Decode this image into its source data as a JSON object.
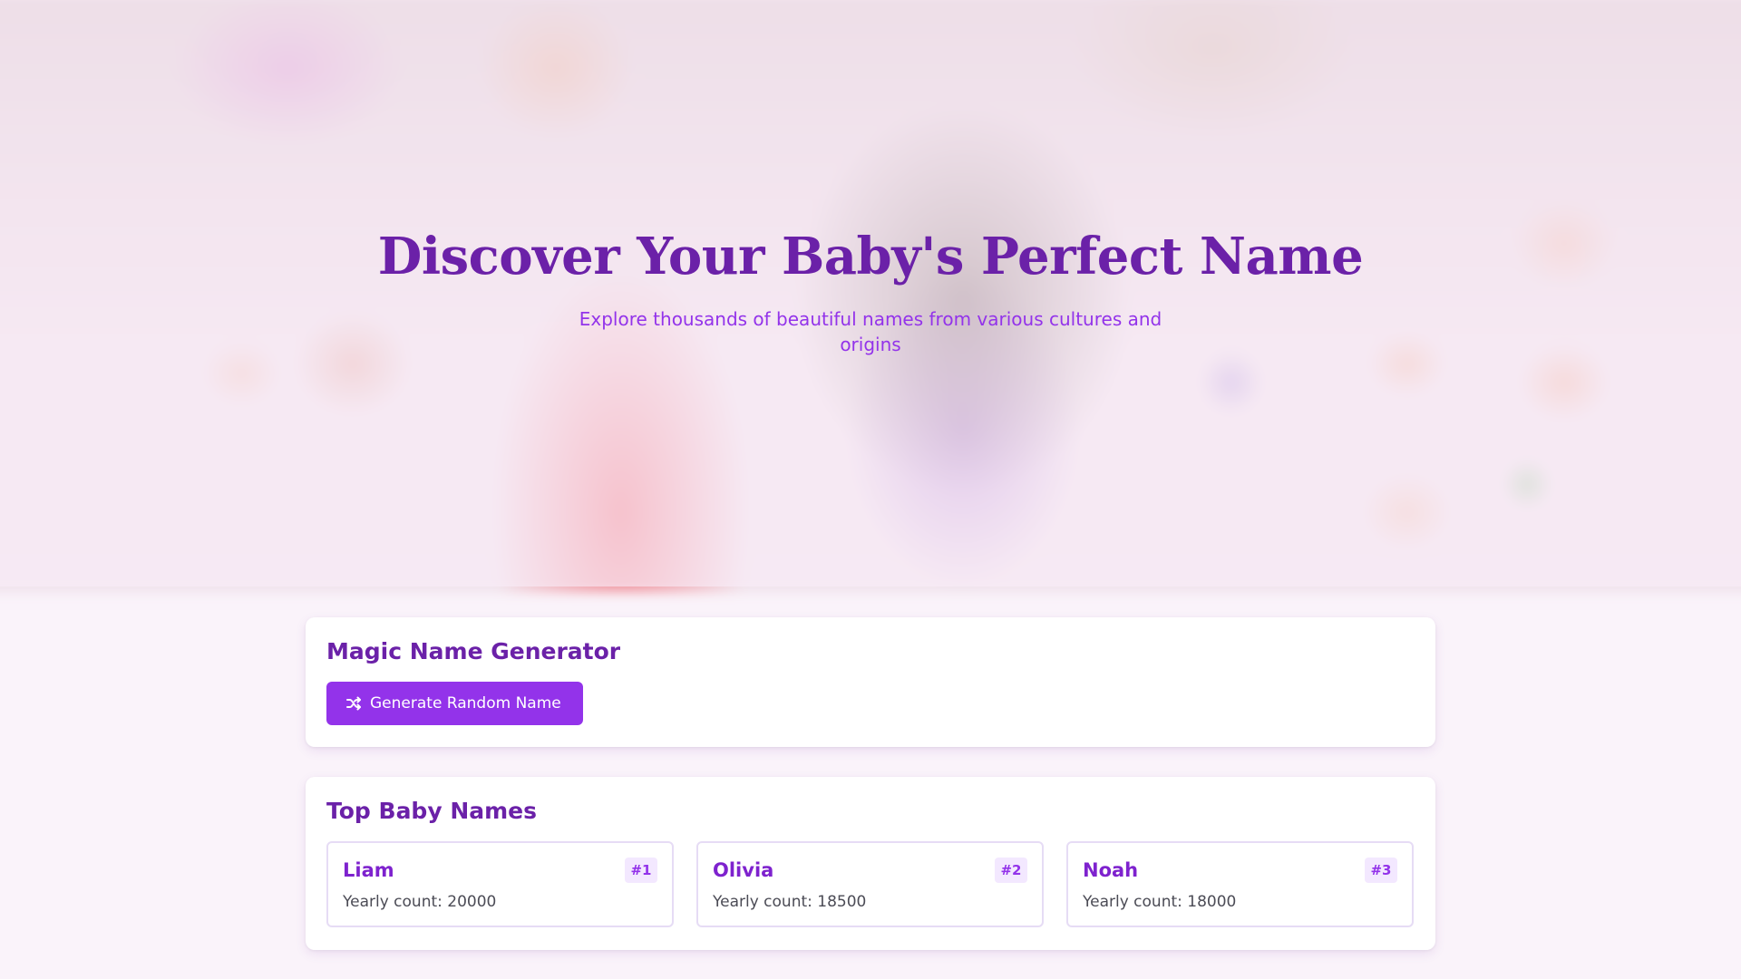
{
  "hero": {
    "title": "Discover Your Baby's Perfect Name",
    "subtitle": "Explore thousands of beautiful names from various cultures and origins"
  },
  "generator": {
    "title": "Magic Name Generator",
    "button_label": "Generate Random Name",
    "button_icon": "shuffle-icon"
  },
  "top_names": {
    "title": "Top Baby Names",
    "count_prefix": "Yearly count: ",
    "items": [
      {
        "name": "Liam",
        "rank": "#1",
        "count_text": "Yearly count: 20000"
      },
      {
        "name": "Olivia",
        "rank": "#2",
        "count_text": "Yearly count: 18500"
      },
      {
        "name": "Noah",
        "rank": "#3",
        "count_text": "Yearly count: 18000"
      }
    ]
  },
  "colors": {
    "primary": "#9333ea",
    "heading": "#6b21a8",
    "badge_bg": "#f3e8ff",
    "page_bg": "#faf3fa"
  }
}
